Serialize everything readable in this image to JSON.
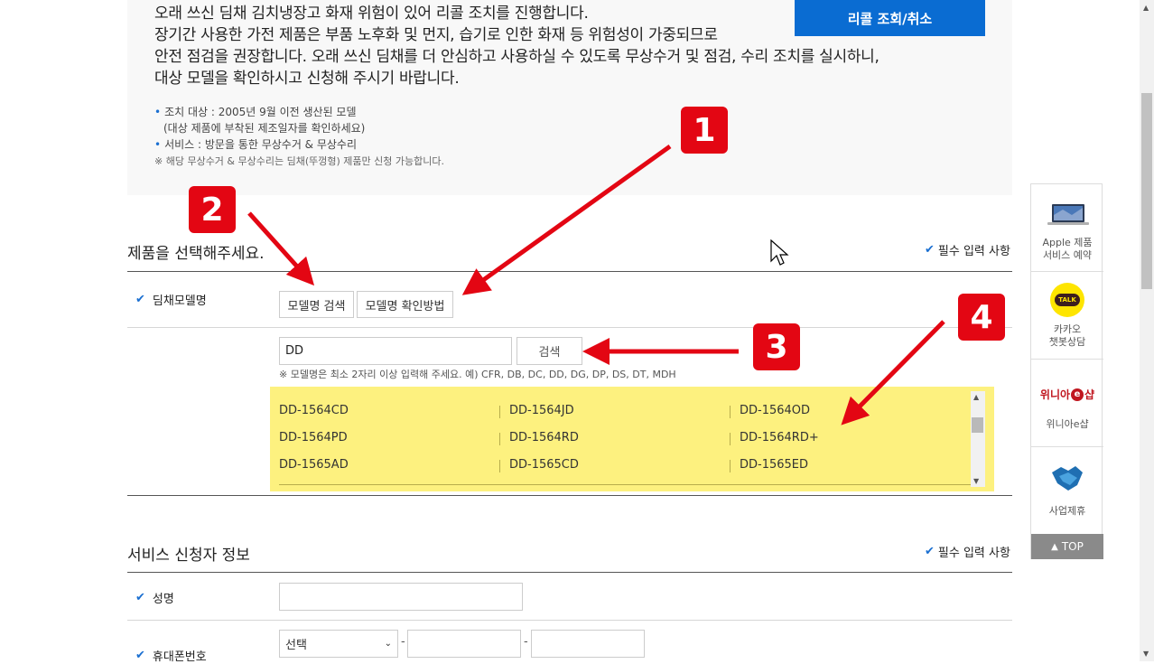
{
  "notice": {
    "lines": [
      "오래 쓰신 딤채 김치냉장고 화재 위험이 있어 리콜 조치를 진행합니다.",
      "장기간 사용한 가전 제품은 부품 노후화 및 먼지, 습기로 인한 화재 등 위험성이 가중되므로",
      "안전 점검을 권장합니다. 오래 쓰신 딤채를 더 안심하고 사용하실 수 있도록 무상수거 및 점검, 수리 조치를 실시하니,",
      "대상 모델을 확인하시고 신청해 주시기 바랍니다."
    ],
    "bullets": [
      "조치 대상 : 2005년 9월 이전 생산된 모델",
      "(대상 제품에 부착된 제조일자를 확인하세요)",
      "서비스 : 방문을 통한 무상수거 & 무상수리"
    ],
    "footnote": "※ 해당 무상수거 & 무상수리는 딤채(뚜껑형) 제품만 신청 가능합니다.",
    "recall_button": "리콜 조회/취소"
  },
  "product_section": {
    "title": "제품을 선택해주세요.",
    "required": "필수 입력 사항",
    "model_label": "딤채모델명",
    "search_model_btn": "모델명 검색",
    "how_to_btn": "모델명 확인방법",
    "search_value": "DD",
    "search_btn": "검색",
    "hint": "※ 모델명은 최소 2자리 이상 입력해 주세요. 예) CFR, DB, DC, DD, DG, DP, DS, DT, MDH",
    "results": [
      [
        "DD-1564CD",
        "DD-1564JD",
        "DD-1564OD"
      ],
      [
        "DD-1564PD",
        "DD-1564RD",
        "DD-1564RD+"
      ],
      [
        "DD-1565AD",
        "DD-1565CD",
        "DD-1565ED"
      ]
    ]
  },
  "applicant_section": {
    "title": "서비스 신청자 정보",
    "required": "필수 입력 사항",
    "name_label": "성명",
    "phone_label": "휴대폰번호",
    "phone_select": "선택"
  },
  "sidebar": {
    "items": [
      {
        "label1": "Apple 제품",
        "label2": "서비스 예약"
      },
      {
        "label1": "카카오",
        "label2": "챗봇상담"
      },
      {
        "label1": "위니아e샵",
        "label2": ""
      },
      {
        "label1": "사업제휴",
        "label2": ""
      }
    ],
    "kakao_talk": "TALK",
    "winia_logo": "위니아",
    "winia_logo_e": "e",
    "winia_logo_shop": "샵",
    "top": "TOP"
  },
  "annotations": [
    "1",
    "2",
    "3",
    "4"
  ],
  "colors": {
    "accent": "#0a6cd2",
    "badge": "#e30613",
    "highlight": "#fdf17f"
  }
}
